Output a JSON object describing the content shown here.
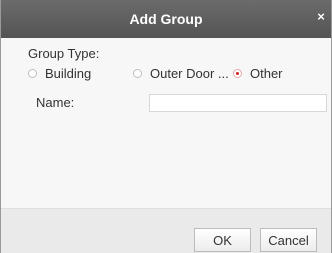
{
  "dialog": {
    "title": "Add Group",
    "close_glyph": "×"
  },
  "group_type": {
    "label": "Group Type:",
    "options": [
      {
        "label": "Building",
        "checked": false
      },
      {
        "label": "Outer Door ...",
        "checked": false
      },
      {
        "label": "Other",
        "checked": true
      }
    ]
  },
  "name": {
    "label": "Name:",
    "value": "",
    "placeholder": ""
  },
  "buttons": {
    "ok": "OK",
    "cancel": "Cancel"
  },
  "colors": {
    "titlebar": "#5e5e5e",
    "radio_selected": "#d21f1f"
  }
}
